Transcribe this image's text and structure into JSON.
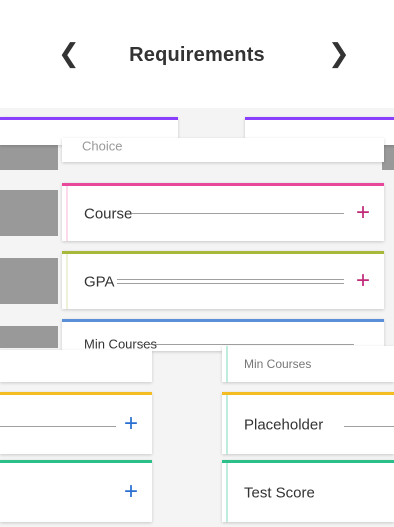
{
  "header": {
    "title": "Requirements",
    "back_icon": "chevron-left-icon",
    "forward_icon": "chevron-right-icon"
  },
  "colors": {
    "purple": "#8a3ffc",
    "pink": "#e8489a",
    "olive": "#a7b83a",
    "blue": "#5b8fd8",
    "yellow": "#f3bd21",
    "green": "#2bbf8a",
    "magenta_plus": "#c02a78",
    "blue_plus": "#2a6fd0"
  },
  "cards": {
    "choice": {
      "label": "Choice"
    },
    "course": {
      "label": "Course",
      "plus": "+"
    },
    "gpa": {
      "label": "GPA",
      "plus": "+"
    },
    "min_courses": {
      "label": "Min Courses"
    },
    "more_courses": {
      "label": "Min Courses"
    },
    "placeholder": {
      "label": "Placeholder"
    },
    "test_score": {
      "label": "Test Score"
    },
    "left_yellow": {
      "plus": "+"
    },
    "left_green": {
      "plus": "+"
    }
  }
}
